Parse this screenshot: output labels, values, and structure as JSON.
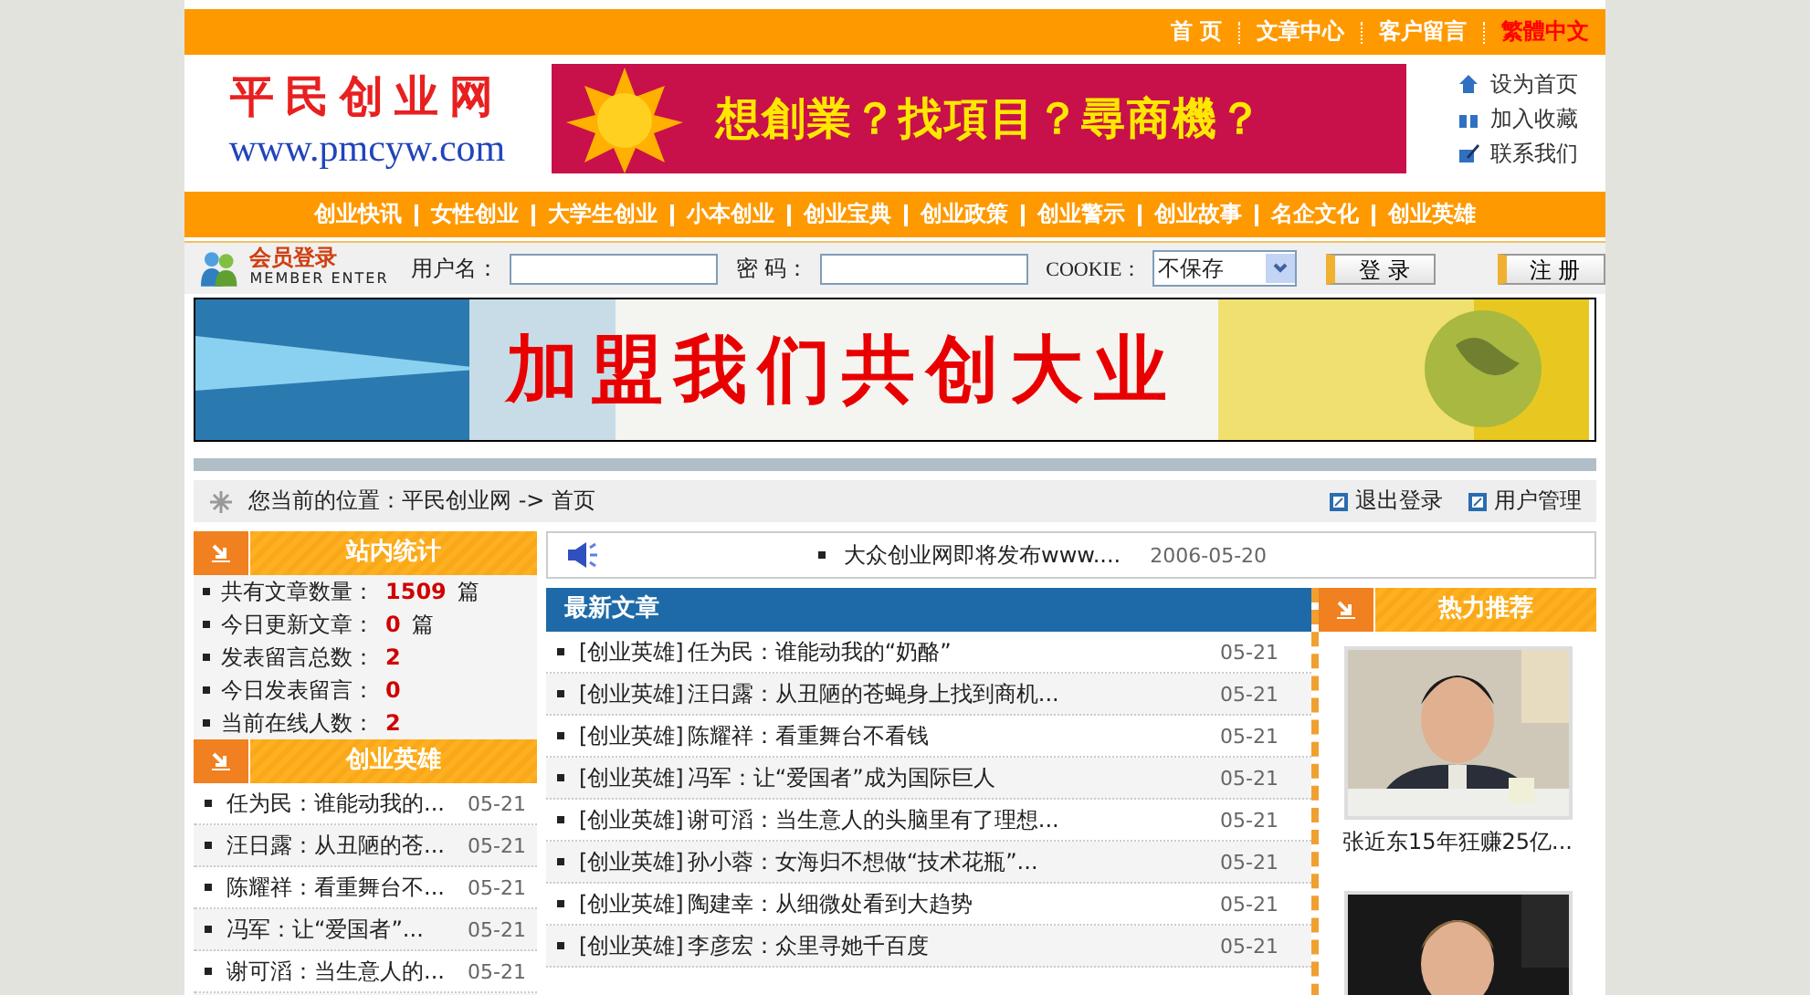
{
  "top_nav": [
    {
      "label": "首 页",
      "kind": "normal"
    },
    {
      "label": "文章中心",
      "kind": "normal"
    },
    {
      "label": "客户留言",
      "kind": "normal"
    },
    {
      "label": "繁體中文",
      "kind": "highlight"
    }
  ],
  "logo": {
    "name": "平民创业网",
    "url": "www.pmcyw.com"
  },
  "banner_ad": {
    "text": "想創業？找項目？尋商機？"
  },
  "header_links": [
    "设为首页",
    "加入收藏",
    "联系我们"
  ],
  "main_nav": [
    "创业快讯",
    "女性创业",
    "大学生创业",
    "小本创业",
    "创业宝典",
    "创业政策",
    "创业警示",
    "创业故事",
    "名企文化",
    "创业英雄"
  ],
  "login": {
    "title": "会员登录",
    "subtitle": "MEMBER ENTER",
    "username_label": "用户名：",
    "password_label": "密 码：",
    "cookie_label": "COOKIE：",
    "cookie_value": "不保存",
    "login_button": "登 录",
    "register_button": "注 册"
  },
  "join_banner": {
    "text": "加盟我们共创大业"
  },
  "breadcrumb": {
    "label": "您当前的位置：",
    "path": "平民创业网 -> 首页",
    "links": [
      "退出登录",
      "用户管理"
    ]
  },
  "stats": {
    "title": "站内统计",
    "items": [
      {
        "label": "共有文章数量：",
        "value": "1509",
        "unit": "篇"
      },
      {
        "label": "今日更新文章：",
        "value": "0",
        "unit": "篇"
      },
      {
        "label": "发表留言总数：",
        "value": "2"
      },
      {
        "label": "今日发表留言：",
        "value": "0"
      },
      {
        "label": "当前在线人数：",
        "value": "2"
      }
    ]
  },
  "heroes": {
    "title": "创业英雄",
    "items": [
      {
        "title": "任为民：谁能动我的...",
        "date": "05-21"
      },
      {
        "title": "汪日露：从丑陋的苍...",
        "date": "05-21"
      },
      {
        "title": "陈耀祥：看重舞台不...",
        "date": "05-21"
      },
      {
        "title": "冯军：让“爱国者”...",
        "date": "05-21"
      },
      {
        "title": "谢可滔：当生意人的...",
        "date": "05-21"
      }
    ]
  },
  "announcement": {
    "text": "大众创业网即将发布www....",
    "date": "2006-05-20"
  },
  "latest": {
    "title": "最新文章",
    "items": [
      {
        "category": "[创业英雄]",
        "title": "任为民：谁能动我的“奶酪”",
        "date": "05-21"
      },
      {
        "category": "[创业英雄]",
        "title": "汪日露：从丑陋的苍蝇身上找到商机...",
        "date": "05-21"
      },
      {
        "category": "[创业英雄]",
        "title": "陈耀祥：看重舞台不看钱",
        "date": "05-21"
      },
      {
        "category": "[创业英雄]",
        "title": "冯军：让“爱国者”成为国际巨人",
        "date": "05-21"
      },
      {
        "category": "[创业英雄]",
        "title": "谢可滔：当生意人的头脑里有了理想...",
        "date": "05-21"
      },
      {
        "category": "[创业英雄]",
        "title": "孙小蓉：女海归不想做“技术花瓶”...",
        "date": "05-21"
      },
      {
        "category": "[创业英雄]",
        "title": "陶建幸：从细微处看到大趋势",
        "date": "05-21"
      },
      {
        "category": "[创业英雄]",
        "title": "李彦宏：众里寻她千百度",
        "date": "05-21"
      }
    ]
  },
  "hot": {
    "title": "热力推荐",
    "items": [
      {
        "kind": "picture",
        "caption": "张近东15年狂赚25亿..."
      },
      {
        "kind": "picture"
      }
    ]
  }
}
